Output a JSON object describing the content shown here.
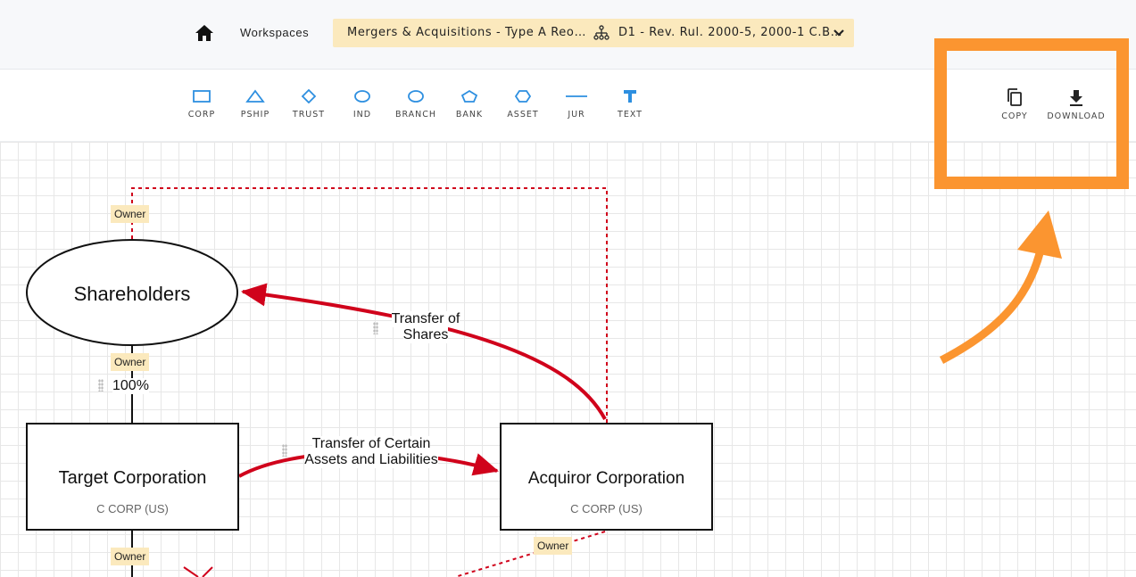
{
  "topbar": {
    "home_icon": "home-icon",
    "workspaces_label": "Workspaces",
    "workspace_title": "Mergers & Acquisitions - Type A Reo…",
    "diagram_icon": "org-chart-icon",
    "diagram_title": "D1 - Rev. Rul. 2000-5, 2000-1 C.B…",
    "dropdown_icon": "chevron-down-icon"
  },
  "toolbar": {
    "tools": [
      {
        "label": "CORP",
        "icon": "rectangle-icon"
      },
      {
        "label": "PSHIP",
        "icon": "triangle-icon"
      },
      {
        "label": "TRUST",
        "icon": "diamond-icon"
      },
      {
        "label": "IND",
        "icon": "ellipse-icon"
      },
      {
        "label": "BRANCH",
        "icon": "oval-icon"
      },
      {
        "label": "BANK",
        "icon": "pentagon-icon"
      },
      {
        "label": "ASSET",
        "icon": "hexagon-icon"
      },
      {
        "label": "JUR",
        "icon": "line-icon"
      },
      {
        "label": "TEXT",
        "icon": "text-icon"
      }
    ],
    "copy_label": "COPY",
    "download_label": "DOWNLOAD"
  },
  "diagram": {
    "nodes": {
      "shareholders": {
        "name": "Shareholders"
      },
      "target": {
        "name": "Target Corporation",
        "type": "C CORP (US)"
      },
      "acquiror": {
        "name": "Acquiror Corporation",
        "type": "C CORP (US)"
      }
    },
    "tags": {
      "owner1": "Owner",
      "owner2": "Owner",
      "owner3": "Owner",
      "owner4": "Owner"
    },
    "ownership_pct": "100%",
    "edges": {
      "transfer_shares_line1": "Transfer of",
      "transfer_shares_line2": "Shares",
      "transfer_assets_line1": "Transfer of Certain",
      "transfer_assets_line2": "Assets and Liabilities"
    }
  },
  "colors": {
    "highlight": "#fb9530",
    "transfer_arrow": "#d0021b",
    "tool_icon": "#2d8fe0",
    "owner_tag": "#fbe9bd"
  }
}
